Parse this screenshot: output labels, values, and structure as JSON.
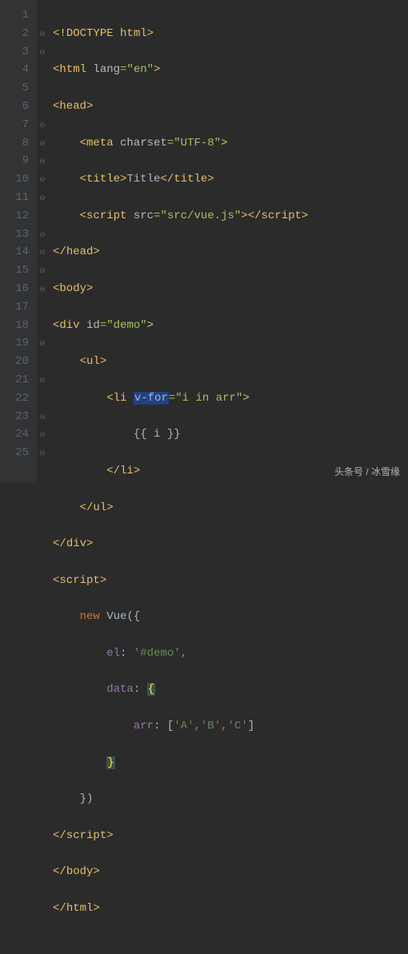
{
  "gutter": [
    "1",
    "2",
    "3",
    "4",
    "5",
    "6",
    "7",
    "8",
    "9",
    "10",
    "11",
    "12",
    "13",
    "14",
    "15",
    "16",
    "17",
    "18",
    "19",
    "20",
    "21",
    "22",
    "23",
    "24",
    "25"
  ],
  "fold": [
    "",
    "⊖",
    "⊖",
    "",
    "",
    "",
    "⊝",
    "⊖",
    "⊖",
    "⊖",
    "⊖",
    "",
    "⊝",
    "⊝",
    "⊝",
    "⊖",
    "",
    "",
    "⊖",
    "",
    "⊝",
    "",
    "⊝",
    "⊝",
    "⊝"
  ],
  "code": {
    "l1": {
      "open": "<!",
      "tag": "DOCTYPE ",
      "attr": "html",
      "close": ">"
    },
    "l2": {
      "open": "<",
      "tag": "html ",
      "attr": "lang",
      "eq": "=",
      "val": "\"en\"",
      "close": ">"
    },
    "l3": {
      "open": "<",
      "tag": "head",
      "close": ">"
    },
    "l4": {
      "open": "<",
      "tag": "meta ",
      "attr": "charset",
      "eq": "=",
      "val": "\"UTF-8\"",
      "close": ">"
    },
    "l5": {
      "open": "<",
      "tag": "title",
      "close": ">",
      "text": "Title",
      "open2": "</",
      "tag2": "title",
      "close2": ">"
    },
    "l6": {
      "open": "<",
      "tag": "script ",
      "attr": "src",
      "eq": "=",
      "val": "\"src/vue.js\"",
      "close": ">",
      "open2": "</",
      "tag2": "script",
      "close2": ">"
    },
    "l7": {
      "open": "</",
      "tag": "head",
      "close": ">"
    },
    "l8": {
      "open": "<",
      "tag": "body",
      "close": ">"
    },
    "l9": {
      "open": "<",
      "tag": "div ",
      "attr": "id",
      "eq": "=",
      "val": "\"demo\"",
      "close": ">"
    },
    "l10": {
      "open": "<",
      "tag": "ul",
      "close": ">"
    },
    "l11": {
      "open": "<",
      "tag": "li ",
      "attr": "v-for",
      "eq": "=",
      "val_open": "\"",
      "val_i": "i ",
      "val_in": "in ",
      "val_arr": "arr",
      "val_close": "\"",
      "close": ">"
    },
    "l12": {
      "text": "{{ i }}"
    },
    "l13": {
      "open": "</",
      "tag": "li",
      "close": ">"
    },
    "l14": {
      "open": "</",
      "tag": "ul",
      "close": ">"
    },
    "l15": {
      "open": "</",
      "tag": "div",
      "close": ">"
    },
    "l16": {
      "open": "<",
      "tag": "script",
      "close": ">"
    },
    "l17": {
      "kw": "new ",
      "ident": "Vue",
      "paren": "({"
    },
    "l18": {
      "key": "el",
      "colon": ": ",
      "val": "'#demo'",
      "comma": ","
    },
    "l19": {
      "key": "data",
      "colon": ": ",
      "brace": "{"
    },
    "l20": {
      "key": "arr",
      "colon": ": [",
      "a": "'A'",
      "c1": ",",
      "b": "'B'",
      "c2": ",",
      "c": "'C'",
      "close": "]"
    },
    "l21": {
      "brace": "}"
    },
    "l22": {
      "close": "})"
    },
    "l23": {
      "open": "</",
      "tag": "script",
      "close": ">"
    },
    "l24": {
      "open": "</",
      "tag": "body",
      "close": ">"
    },
    "l25": {
      "open": "</",
      "tag": "html",
      "close": ">"
    }
  },
  "watermark": "头条号 / 冰雪缘"
}
